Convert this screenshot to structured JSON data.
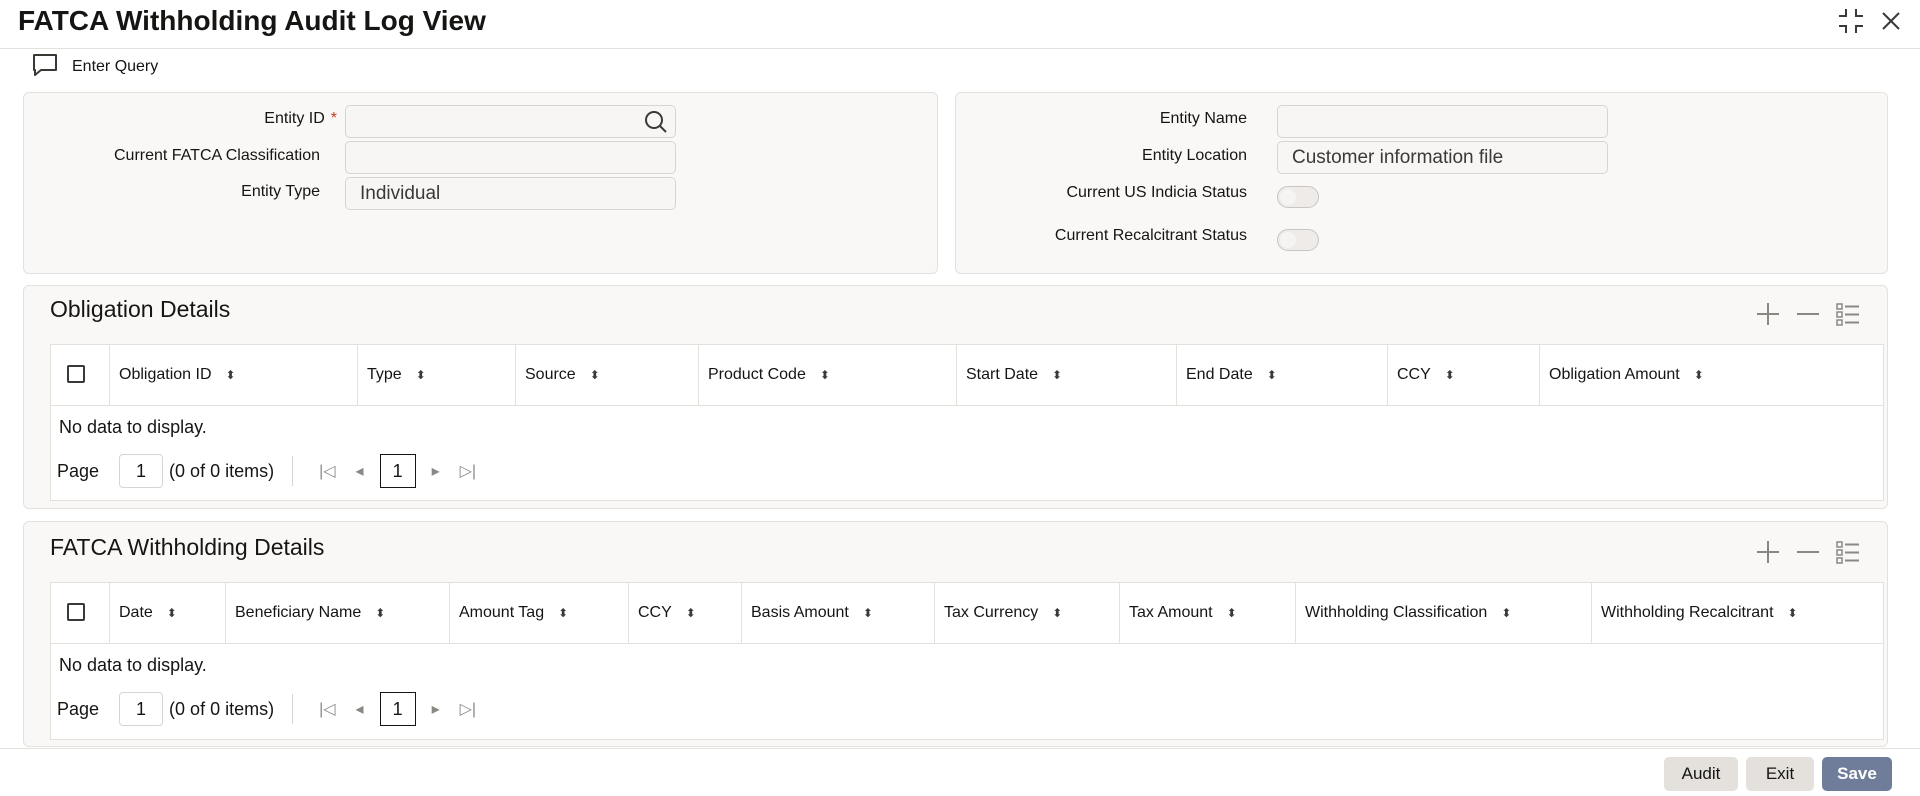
{
  "window": {
    "title": "FATCA Withholding Audit Log View"
  },
  "toolbar": {
    "enter_query_label": "Enter Query"
  },
  "entity_form": {
    "entity_id_label": "Entity ID",
    "entity_id_required": "*",
    "entity_id_value": "",
    "fatca_class_label": "Current FATCA Classification",
    "fatca_class_value": "",
    "entity_type_label": "Entity Type",
    "entity_type_value": "Individual",
    "entity_name_label": "Entity Name",
    "entity_name_value": "",
    "entity_location_label": "Entity Location",
    "entity_location_value": "Customer information file",
    "us_indicia_label": "Current US Indicia Status",
    "recalcitrant_label": "Current Recalcitrant Status"
  },
  "obligation": {
    "title": "Obligation Details",
    "columns": [
      "Obligation ID",
      "Type",
      "Source",
      "Product Code",
      "Start Date",
      "End Date",
      "CCY",
      "Obligation Amount"
    ],
    "empty_text": "No data to display.",
    "page_label": "Page",
    "page_value": "1",
    "items_text": "(0 of 0 items)",
    "current_page": "1"
  },
  "withholding": {
    "title": "FATCA Withholding Details",
    "columns": [
      "Date",
      "Beneficiary Name",
      "Amount Tag",
      "CCY",
      "Basis Amount",
      "Tax Currency",
      "Tax Amount",
      "Withholding Classification",
      "Withholding Recalcitrant"
    ],
    "empty_text": "No data to display.",
    "page_label": "Page",
    "page_value": "1",
    "items_text": "(0 of 0 items)",
    "current_page": "1"
  },
  "footer": {
    "audit_label": "Audit",
    "exit_label": "Exit",
    "save_label": "Save"
  },
  "colors": {
    "primary_button": "#6f7d9a",
    "required_marker": "#c23b1e",
    "panel_background": "#f9f8f7"
  }
}
